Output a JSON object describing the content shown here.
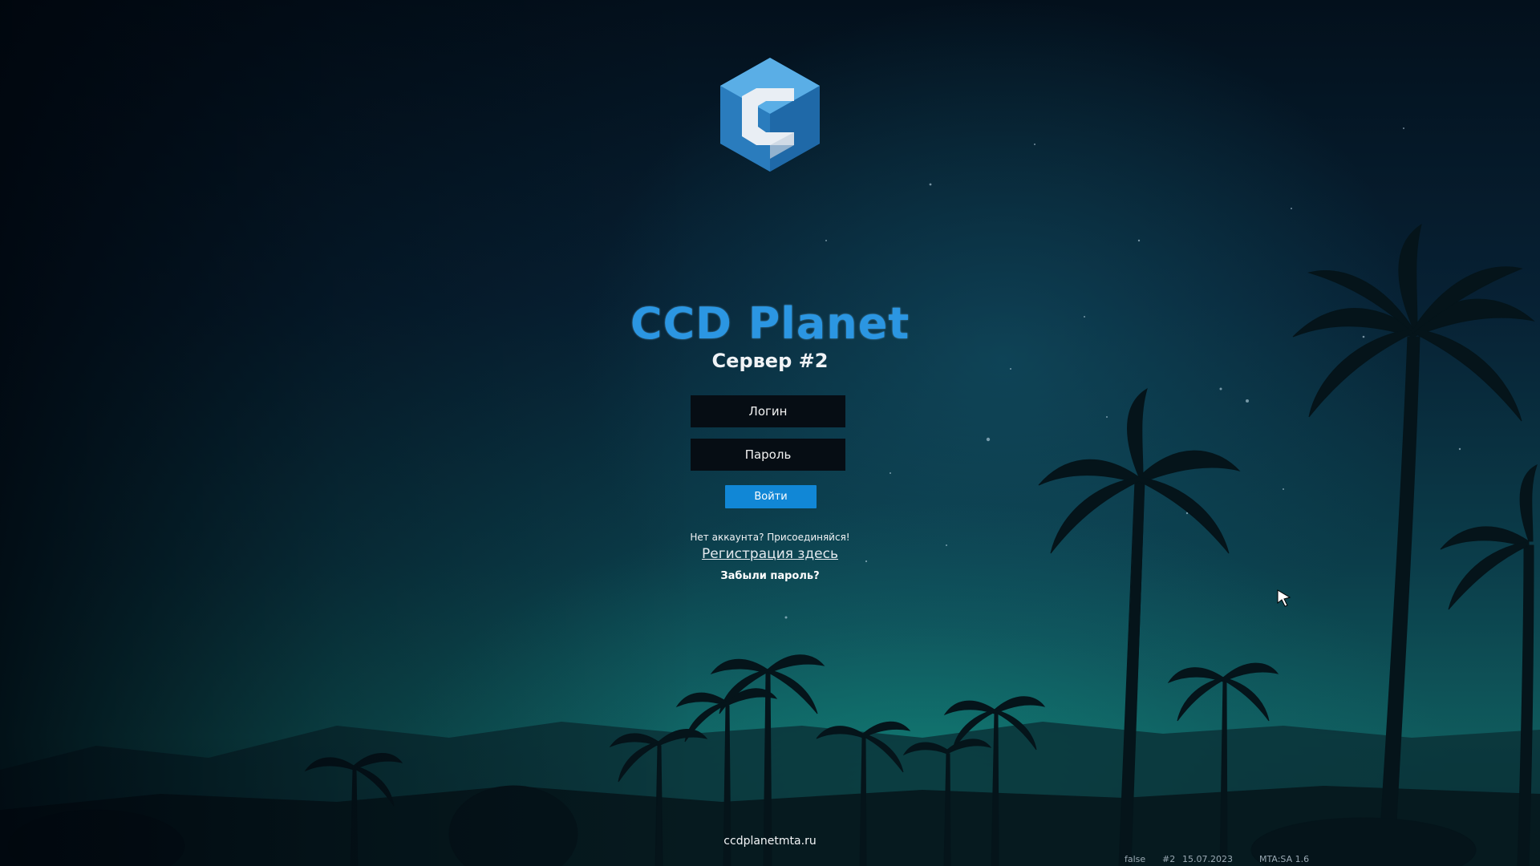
{
  "brand": {
    "logo_icon": "ccd-cube-logo",
    "title": "CCD Planet",
    "server": "Сервер #2",
    "accent_color": "#2b96e2"
  },
  "login_form": {
    "login_placeholder": "Логин",
    "password_placeholder": "Пароль",
    "submit_label": "Войти",
    "submit_color": "#1187d6"
  },
  "links": {
    "no_account_text": "Нет аккаунта? Присоединяйся!",
    "register_label": "Регистрация здесь",
    "forgot_label": "Забыли пароль?"
  },
  "footer": {
    "website": "ccdplanetmta.ru"
  },
  "status_bar": {
    "flag": "false",
    "server_tag": "#2",
    "date": "15.07.2023",
    "client_version": "MTA:SA 1.6"
  },
  "cursor_icon": "pointer-arrow-icon"
}
